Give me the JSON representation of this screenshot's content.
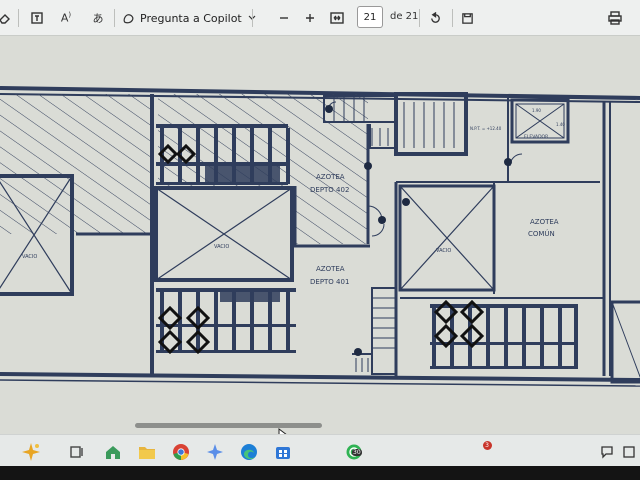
{
  "toolbar": {
    "copilot_label": "Pregunta a Copilot",
    "page_current": "21",
    "page_of": "de 21",
    "icons": [
      "eraser-icon",
      "text-box-icon",
      "read-aloud-icon",
      "translate-icon",
      "copilot-icon",
      "chevron-down-icon",
      "zoom-out-icon",
      "zoom-in-icon",
      "fit-width-icon",
      "rotate-icon",
      "save-icon",
      "print-icon"
    ]
  },
  "plan": {
    "labels": {
      "azotea_402": "AZOTEA",
      "depto_402": "DEPTO 402",
      "azotea_401": "AZOTEA",
      "depto_401": "DEPTO 401",
      "azotea_comun": "AZOTEA",
      "comun": "COMÚN",
      "vacio": "VACIO",
      "elevador": "ELEVADOR",
      "npt": "N.P.T. = +12.40",
      "dim_a": "1.90",
      "dim_b": "1.40"
    }
  },
  "taskbar": {
    "icons": [
      "copilot-sparkle-icon",
      "task-view-icon",
      "home-icon",
      "file-explorer-icon",
      "chrome-icon",
      "copilot-app-icon",
      "edge-icon",
      "store-icon",
      "whatsapp-icon"
    ],
    "whatsapp_badge": "30",
    "tray_badge": "3",
    "tray_icons": [
      "chat-icon",
      "notifications-icon"
    ]
  },
  "colors": {
    "line": "#2f3d5c",
    "paper": "#dadcd6",
    "toolbar": "#eef0ef",
    "taskbar": "#e6e9e8"
  }
}
